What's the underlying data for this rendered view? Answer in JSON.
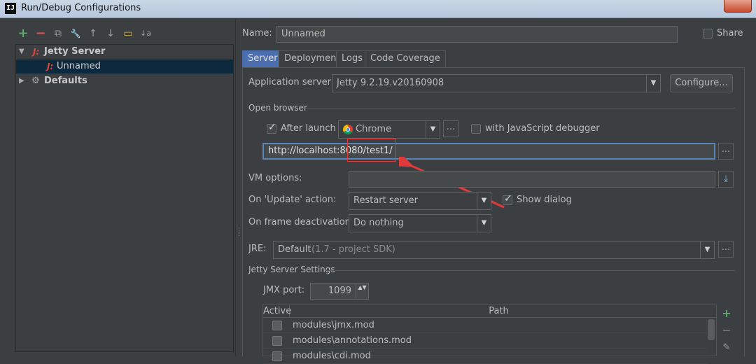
{
  "window": {
    "title": "Run/Debug Configurations",
    "logo_text": "IJ"
  },
  "toolbar": {
    "add_icon": "+",
    "remove_icon": "−",
    "copy_icon": "⧉",
    "edit_defaults_icon": "🔧",
    "move_up_icon": "↑",
    "move_down_icon": "↓",
    "folder_icon": "▭",
    "sort_icon": "↓a"
  },
  "tree": {
    "jetty_server": "Jetty Server",
    "unnamed": "Unnamed",
    "defaults": "Defaults",
    "jetty_icon_text": "J:"
  },
  "form": {
    "name_label": "Name:",
    "name_value": "Unnamed",
    "share_label": "Share",
    "tabs": [
      "Server",
      "Deployment",
      "Logs",
      "Code Coverage"
    ],
    "app_server_label": "Application server:",
    "app_server_value": "Jetty 9.2.19.v20160908",
    "configure_button": "Configure...",
    "open_browser_label": "Open browser",
    "after_launch_label": "After launch",
    "browser_value": "Chrome",
    "js_debugger_label": "with JavaScript debugger",
    "url_value": "http://localhost:8080/test1/",
    "vm_options_label": "VM options:",
    "vm_options_value": "",
    "update_action_label": "On 'Update' action:",
    "update_action_value": "Restart server",
    "show_dialog_label": "Show dialog",
    "frame_deactivation_label": "On frame deactivation:",
    "frame_deactivation_value": "Do nothing",
    "jre_label": "JRE:",
    "jre_value": "Default",
    "jre_hint": "(1.7 - project SDK)",
    "jetty_settings_label": "Jetty Server Settings",
    "jmx_port_label": "JMX port:",
    "jmx_port_value": "1099",
    "dots_label": "...",
    "dropdown_icon": "▼",
    "spinner_icon": "▲▼",
    "table": {
      "headers": [
        "Active",
        "Path"
      ],
      "rows": [
        "modules\\jmx.mod",
        "modules\\annotations.mod",
        "modules\\cdi.mod"
      ]
    },
    "table_add_icon": "+",
    "table_remove_icon": "−",
    "table_edit_icon": "✎"
  },
  "colors": {
    "accent": "#4b6eaf",
    "annotation": "#e03a3a",
    "add_green": "#59a869",
    "remove_red": "#d9534f"
  }
}
